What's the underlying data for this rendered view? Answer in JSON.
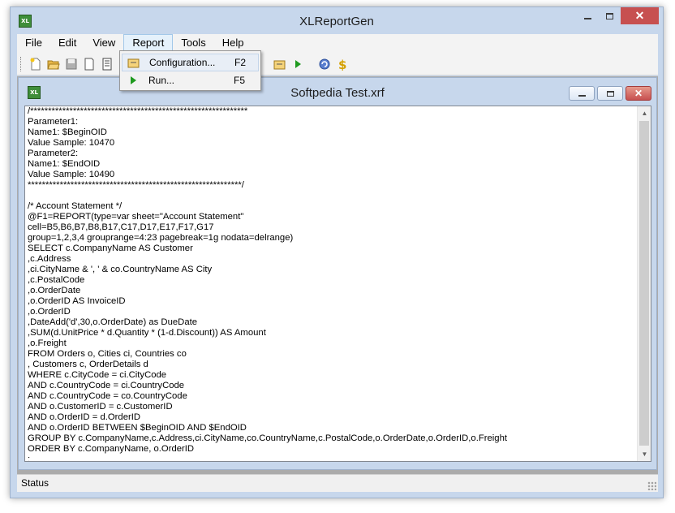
{
  "app": {
    "title": "XLReportGen",
    "icon_text": "XL"
  },
  "window_controls": {
    "close_glyph": "✕"
  },
  "menu": {
    "items": [
      {
        "label": "File"
      },
      {
        "label": "Edit"
      },
      {
        "label": "View"
      },
      {
        "label": "Report"
      },
      {
        "label": "Tools"
      },
      {
        "label": "Help"
      }
    ],
    "open_menu": "Report",
    "report_dropdown": [
      {
        "label": "Configuration...",
        "shortcut": "F2",
        "icon": "configuration-icon"
      },
      {
        "label": "Run...",
        "shortcut": "F5",
        "icon": "run-icon"
      }
    ]
  },
  "toolbar": {
    "buttons": [
      "new-icon",
      "open-icon",
      "save-icon",
      "page-icon",
      "print-preview-icon",
      "configuration-icon",
      "run-icon",
      "refresh-icon",
      "dollar-icon"
    ]
  },
  "document": {
    "title": "Softpedia Test.xrf",
    "icon_text": "XL",
    "lines": [
      "/*************************************************************",
      "Parameter1:",
      "Name1: $BeginOID",
      "Value Sample: 10470",
      "Parameter2:",
      "Name1: $EndOID",
      "Value Sample: 10490",
      "************************************************************/",
      "",
      "/* Account Statement */",
      "@F1=REPORT(type=var sheet=\"Account Statement\"",
      "cell=B5,B6,B7,B8,B17,C17,D17,E17,F17,G17",
      "group=1,2,3,4 grouprange=4:23 pagebreak=1g nodata=delrange)",
      "SELECT c.CompanyName AS Customer",
      ",c.Address",
      ",ci.CityName & ', ' & co.CountryName AS City",
      ",c.PostalCode",
      ",o.OrderDate",
      ",o.OrderID AS InvoiceID",
      ",o.OrderID",
      ",DateAdd('d',30,o.OrderDate) as DueDate",
      ",SUM(d.UnitPrice * d.Quantity * (1-d.Discount)) AS Amount",
      ",o.Freight",
      "FROM Orders o, Cities ci, Countries co",
      ", Customers c, OrderDetails d",
      "WHERE c.CityCode = ci.CityCode",
      "AND c.CountryCode = ci.CountryCode",
      "AND c.CountryCode = co.CountryCode",
      "AND o.CustomerID = c.CustomerID",
      "AND o.OrderID = d.OrderID",
      "AND o.OrderID BETWEEN $BeginOID AND $EndOID",
      "GROUP BY c.CompanyName,c.Address,ci.CityName,co.CountryName,c.PostalCode,o.OrderDate,o.OrderID,o.Freight",
      "ORDER BY c.CompanyName, o.OrderID",
      ";"
    ]
  },
  "status": {
    "text": "Status"
  },
  "colors": {
    "titlebar": "#c7d7ec",
    "close_button": "#c75050",
    "menubar": "#f3f3f3",
    "run_green": "#1f9a1f",
    "dollar_gold": "#d4a000"
  }
}
